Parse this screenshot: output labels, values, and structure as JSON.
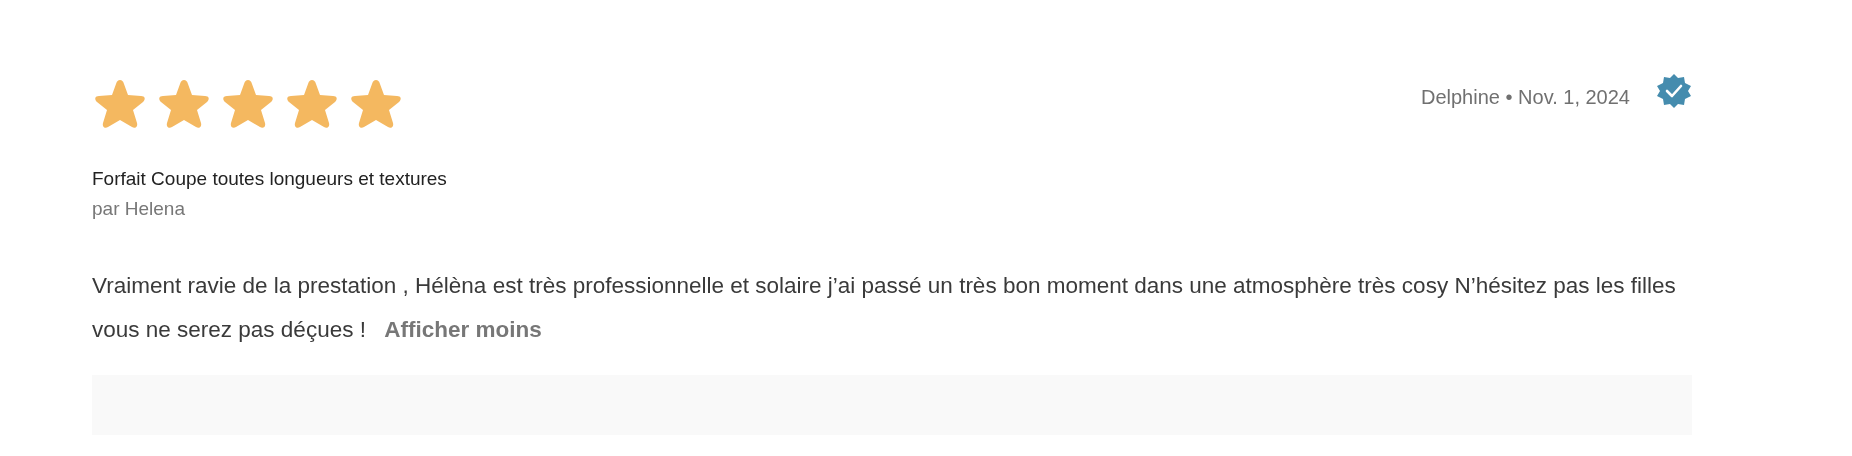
{
  "review": {
    "stars": 5,
    "author": "Delphine",
    "separator": "•",
    "date": "Nov. 1, 2024",
    "verified": true,
    "service": "Forfait Coupe toutes longueurs et textures",
    "staff": "par Helena",
    "text": "Vraiment ravie de la prestation , Hélèna est très professionnelle et solaire j’ai passé un très bon moment dans une atmosphère très cosy N’hésitez pas les filles vous ne serez pas déçues !",
    "toggle_link": "Afficher moins"
  }
}
